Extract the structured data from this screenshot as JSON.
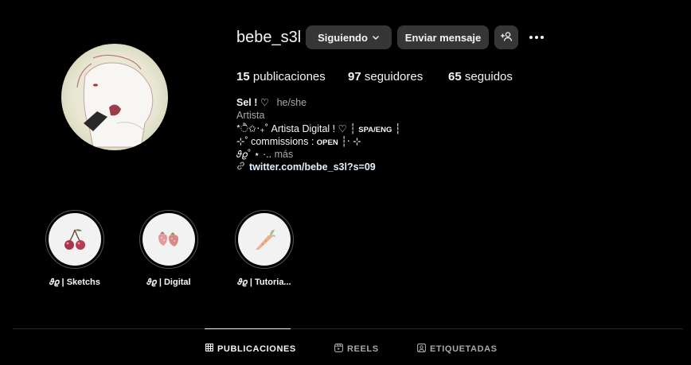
{
  "profile": {
    "username": "bebe_s3l",
    "following_button": "Siguiendo",
    "message_button": "Enviar mensaje",
    "stats": {
      "posts_count": "15",
      "posts_label": "publicaciones",
      "followers_count": "97",
      "followers_label": "seguidores",
      "following_count": "65",
      "following_label": "seguidos"
    },
    "bio": {
      "name": "Sel ! ♡",
      "pronouns": "he/she",
      "category": "Artista",
      "line1_main": "*ੈ✩‧₊˚ Artista Digital ! ♡ ┆",
      "line1_small": "SPA/ENG",
      "line1_end": "┆",
      "line2_main": "⊹˚ commissions :",
      "line2_small": "OPEN",
      "line2_end": "┆‧ ⊹",
      "line3_main": "𝜗𝜚˚ ⋆ ·..",
      "line3_more": "más",
      "link": "twitter.com/bebe_s3l?s=09"
    }
  },
  "highlights": [
    {
      "label": "𝜗𝜚 | Sketchs",
      "icon": "cherry-icon"
    },
    {
      "label": "𝜗𝜚 | Digital",
      "icon": "strawberry-icon"
    },
    {
      "label": "𝜗𝜚 | Tutoria...",
      "icon": "carrot-icon"
    }
  ],
  "tabs": [
    {
      "label": "PUBLICACIONES",
      "icon": "grid-icon",
      "active": true
    },
    {
      "label": "REELS",
      "icon": "reels-icon",
      "active": false
    },
    {
      "label": "ETIQUETADAS",
      "icon": "tag-icon",
      "active": false
    }
  ],
  "colors": {
    "background": "#000000",
    "button": "#363636",
    "secondary_text": "#a8a8a8",
    "link_text": "#e0f1ff",
    "divider": "#262626"
  }
}
